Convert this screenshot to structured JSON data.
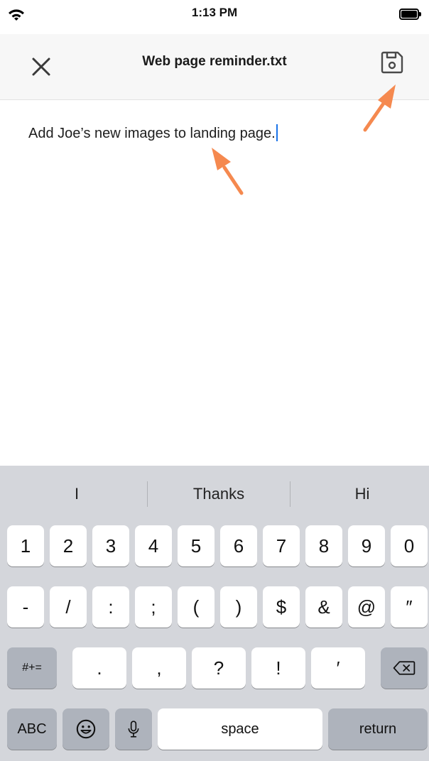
{
  "status_bar": {
    "time": "1:13 PM"
  },
  "header": {
    "title": "Web page reminder.txt"
  },
  "editor": {
    "text": "Add Joe’s new images to landing page."
  },
  "keyboard": {
    "predictions": [
      "I",
      "Thanks",
      "Hi"
    ],
    "row1": [
      "1",
      "2",
      "3",
      "4",
      "5",
      "6",
      "7",
      "8",
      "9",
      "0"
    ],
    "row2": [
      "-",
      "/",
      ":",
      ";",
      "(",
      ")",
      "$",
      "&",
      "@",
      "″"
    ],
    "row3_left": "#+=",
    "row3": [
      ".",
      ",",
      "?",
      "!",
      "′"
    ],
    "row4": {
      "abc": "ABC",
      "space": "space",
      "return": "return"
    }
  },
  "colors": {
    "accent_arrow": "#f5894f",
    "caret": "#1a73e8",
    "keyboard_bg": "#d4d6db"
  },
  "icons": [
    "wifi-icon",
    "battery-icon",
    "close-icon",
    "save-icon",
    "emoji-icon",
    "microphone-icon",
    "backspace-icon"
  ]
}
